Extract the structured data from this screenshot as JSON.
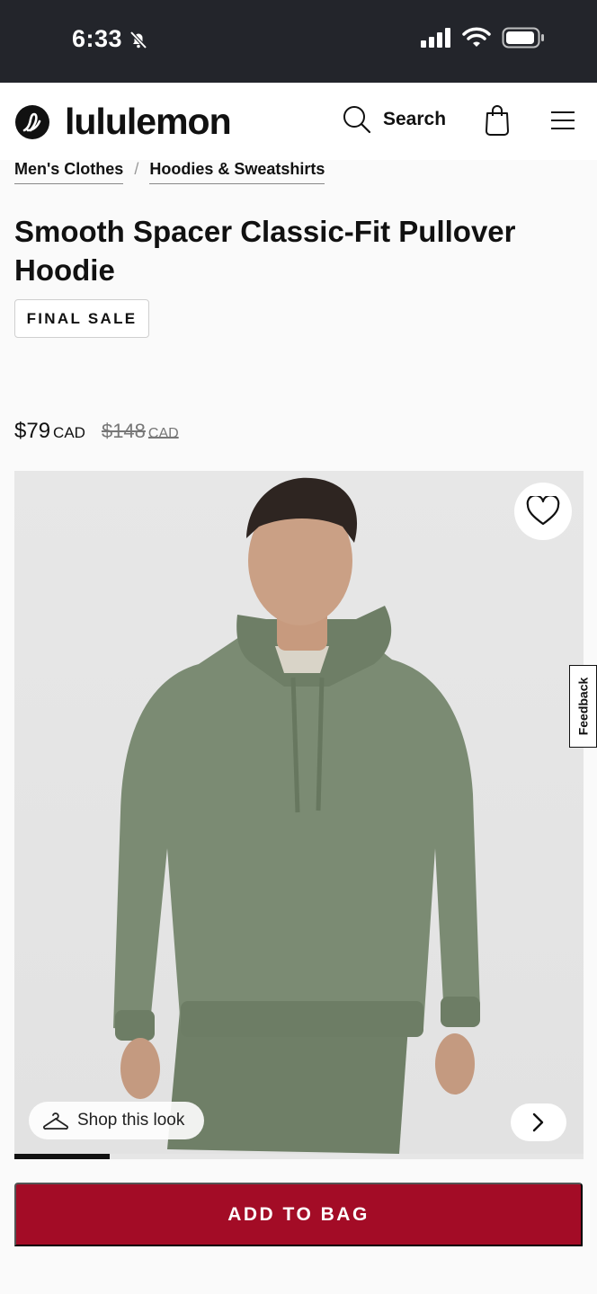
{
  "status_bar": {
    "time": "6:33"
  },
  "header": {
    "brand": "lululemon",
    "search_label": "Search"
  },
  "breadcrumb": [
    "Men's Clothes",
    "Hoodies & Sweatshirts"
  ],
  "product": {
    "title": "Smooth Spacer Classic-Fit Pullover Hoodie",
    "badge": "FINAL SALE",
    "price": "$79",
    "price_currency": "CAD",
    "original_price": "$148",
    "original_currency": "CAD",
    "color": "#7b8b73"
  },
  "gallery": {
    "shop_look_label": "Shop this look",
    "image_index": 1,
    "image_count": 6,
    "background": "#e5e5e5"
  },
  "feedback_label": "Feedback",
  "cta": {
    "add_to_bag_label": "ADD TO BAG",
    "color": "#a30c26"
  },
  "icons": [
    "bell-slash-icon",
    "signal-icon",
    "wifi-icon",
    "battery-icon",
    "lululemon-logo-icon",
    "search-icon",
    "bag-icon",
    "menu-icon",
    "heart-icon",
    "hanger-icon",
    "chevron-right-icon"
  ]
}
